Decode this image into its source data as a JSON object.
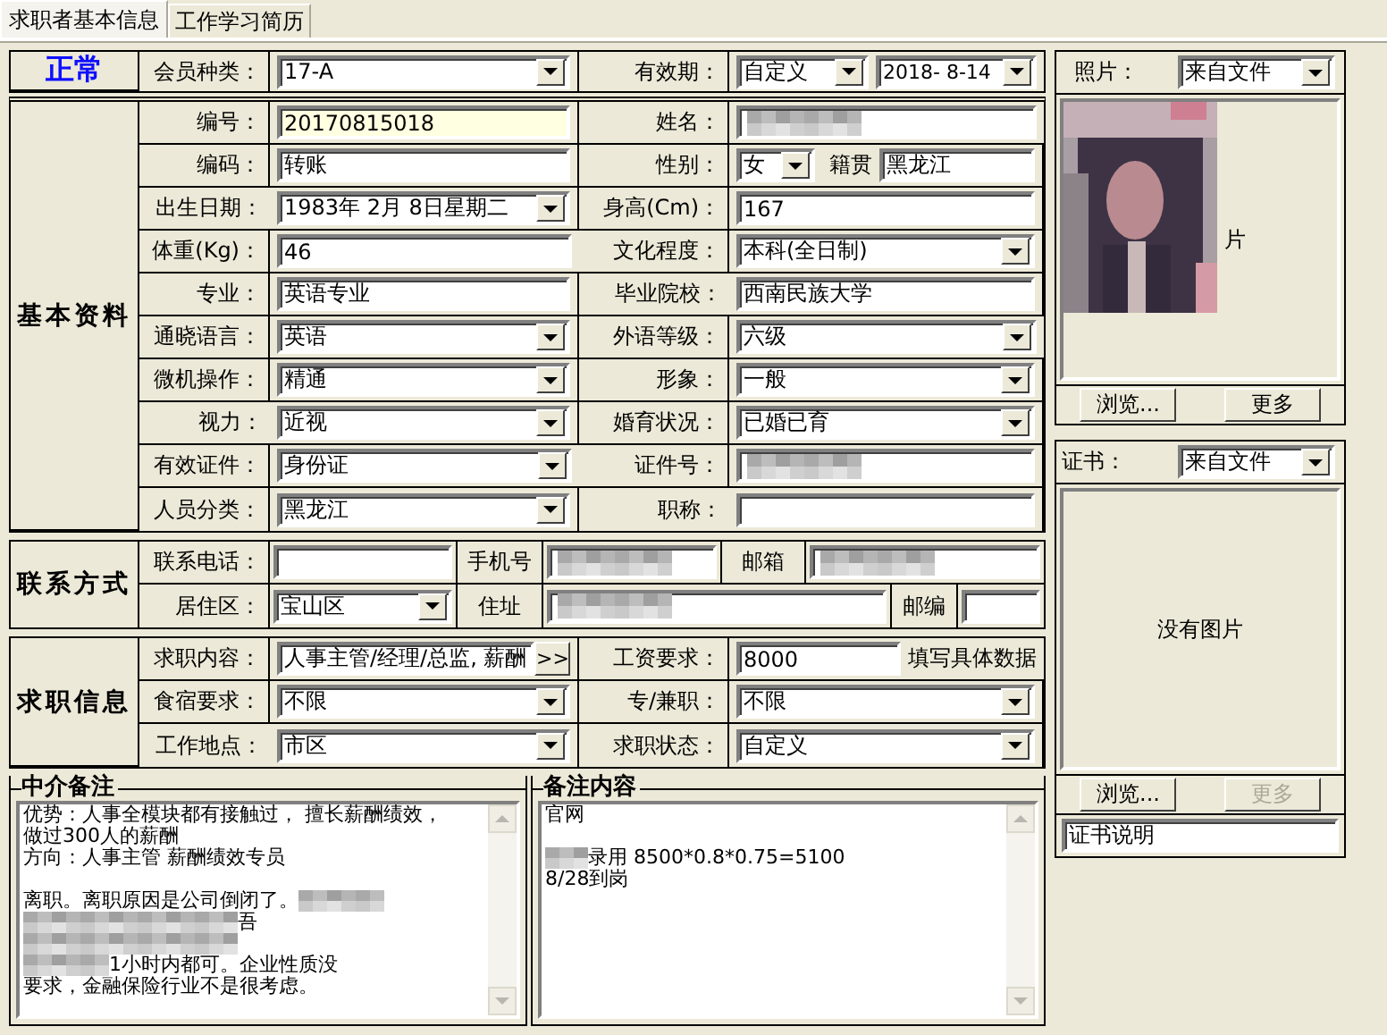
{
  "tabs": [
    {
      "label": "求职者基本信息",
      "selected": true
    },
    {
      "label": "工作学习简历",
      "selected": false
    }
  ],
  "status": "正常",
  "header": {
    "left": {
      "label": "会员种类：",
      "kind": "select",
      "value": "17-A"
    },
    "right": {
      "label": "有效期：",
      "kind": "select_pair",
      "value": "自定义",
      "value2": "2018- 8-14"
    }
  },
  "basic": {
    "title": "基本资料",
    "rows": [
      {
        "left": {
          "label": "编号：",
          "kind": "input",
          "value": "20170815018",
          "highlighted": true
        },
        "right": {
          "label": "姓名：",
          "kind": "redacted"
        }
      },
      {
        "left": {
          "label": "编码：",
          "kind": "input",
          "value": "转账",
          "highlighted": false
        },
        "right": {
          "label": "性别：",
          "kind": "select_extra",
          "value": "女",
          "extra_label": "籍贯",
          "extra_value": "黑龙江"
        }
      },
      {
        "left": {
          "label": "出生日期：",
          "kind": "select",
          "value": "1983年 2月 8日星期二"
        },
        "right": {
          "label": "身高(Cm)：",
          "kind": "input",
          "value": "167",
          "highlighted": false
        }
      },
      {
        "left": {
          "label": "体重(Kg)：",
          "kind": "input",
          "value": "46",
          "highlighted": false
        },
        "right": {
          "label": "文化程度：",
          "kind": "select",
          "value": "本科(全日制)"
        }
      },
      {
        "left": {
          "label": "专业：",
          "kind": "input",
          "value": "英语专业",
          "highlighted": false
        },
        "right": {
          "label": "毕业院校：",
          "kind": "input",
          "value": "西南民族大学",
          "highlighted": false
        }
      },
      {
        "left": {
          "label": "通晓语言：",
          "kind": "select",
          "value": "英语"
        },
        "right": {
          "label": "外语等级：",
          "kind": "select",
          "value": "六级"
        }
      },
      {
        "left": {
          "label": "微机操作：",
          "kind": "select",
          "value": "精通"
        },
        "right": {
          "label": "形象：",
          "kind": "select",
          "value": "一般"
        }
      },
      {
        "left": {
          "label": "视力：",
          "kind": "select",
          "value": "近视"
        },
        "right": {
          "label": "婚育状况：",
          "kind": "select",
          "value": "已婚已育"
        }
      },
      {
        "left": {
          "label": "有效证件：",
          "kind": "select",
          "value": "身份证"
        },
        "right": {
          "label": "证件号：",
          "kind": "redacted"
        }
      },
      {
        "left": {
          "label": "人员分类：",
          "kind": "select",
          "value": "黑龙江"
        },
        "right": {
          "label": "职称：",
          "kind": "input",
          "highlighted": false
        }
      }
    ]
  },
  "contact": {
    "title": "联系方式",
    "rows": [
      {
        "label": "联系电话：",
        "fields": [
          {
            "kind": "input",
            "highlighted": false
          },
          {
            "kind": "label",
            "value": "手机号"
          },
          {
            "kind": "redacted"
          },
          {
            "kind": "label",
            "value": "邮箱"
          },
          {
            "kind": "redacted"
          }
        ]
      },
      {
        "label": "居住区：",
        "fields": [
          {
            "kind": "select",
            "value": "宝山区"
          },
          {
            "kind": "label",
            "value": "住址"
          },
          {
            "kind": "redacted"
          },
          {
            "kind": "label",
            "value": "邮编"
          },
          {
            "kind": "input",
            "highlighted": false
          }
        ]
      }
    ]
  },
  "job": {
    "title": "求职信息",
    "rows": [
      {
        "left": {
          "label": "求职内容：",
          "kind": "input_more",
          "value": "人事主管/经理/总监, 薪酬",
          "button": ">>"
        },
        "right": {
          "label": "工资要求：",
          "kind": "input_note",
          "value": "8000",
          "note": "填写具体数据"
        }
      },
      {
        "left": {
          "label": "食宿要求：",
          "kind": "select",
          "value": "不限"
        },
        "right": {
          "label": "专/兼职：",
          "kind": "select",
          "value": "不限"
        }
      },
      {
        "left": {
          "label": "工作地点：",
          "kind": "select",
          "value": "市区"
        },
        "right": {
          "label": "求职状态：",
          "kind": "select",
          "value": "自定义"
        }
      }
    ]
  },
  "agency_note": {
    "title": "中介备注",
    "lines": [
      [
        {
          "kind": "text",
          "text": "优势：人事全模块都有接触过， 擅长薪酬绩效，"
        }
      ],
      [
        {
          "kind": "text",
          "text": "做过300人的薪酬"
        }
      ],
      [
        {
          "kind": "text",
          "text": "方向：人事主管 薪酬绩效专员"
        }
      ],
      [
        {
          "kind": "blank"
        }
      ],
      [
        {
          "kind": "text",
          "text": "离职。离职原因是公司倒闭了。"
        },
        {
          "kind": "blur_m"
        }
      ],
      [
        {
          "kind": "blur_l"
        },
        {
          "kind": "text",
          "text": "吾"
        }
      ],
      [
        {
          "kind": "blur_l"
        }
      ],
      [
        {
          "kind": "blur_m"
        },
        {
          "kind": "text",
          "text": "1小时内都可。企业性质没"
        }
      ],
      [
        {
          "kind": "text",
          "text": "要求，金融保险行业不是很考虑。"
        }
      ]
    ]
  },
  "remarks": {
    "title": "备注内容",
    "lines": [
      [
        {
          "kind": "text",
          "text": "官网"
        }
      ],
      [
        {
          "kind": "blank"
        }
      ],
      [
        {
          "kind": "blur_s"
        },
        {
          "kind": "text",
          "text": "录用 8500*0.8*0.75=5100"
        }
      ],
      [
        {
          "kind": "text",
          "text": "8/28到岗"
        }
      ]
    ]
  },
  "photo": {
    "label": "照片：",
    "source": "来自文件",
    "overlay_text": "片",
    "buttons": [
      {
        "label": "浏览...",
        "disabled": false
      },
      {
        "label": "更多",
        "disabled": false
      }
    ]
  },
  "certificate": {
    "label": "证书：",
    "source": "来自文件",
    "empty_text": "没有图片",
    "buttons": [
      {
        "label": "浏览...",
        "disabled": false
      },
      {
        "label": "更多",
        "disabled": true
      }
    ],
    "caption": "证书说明"
  }
}
